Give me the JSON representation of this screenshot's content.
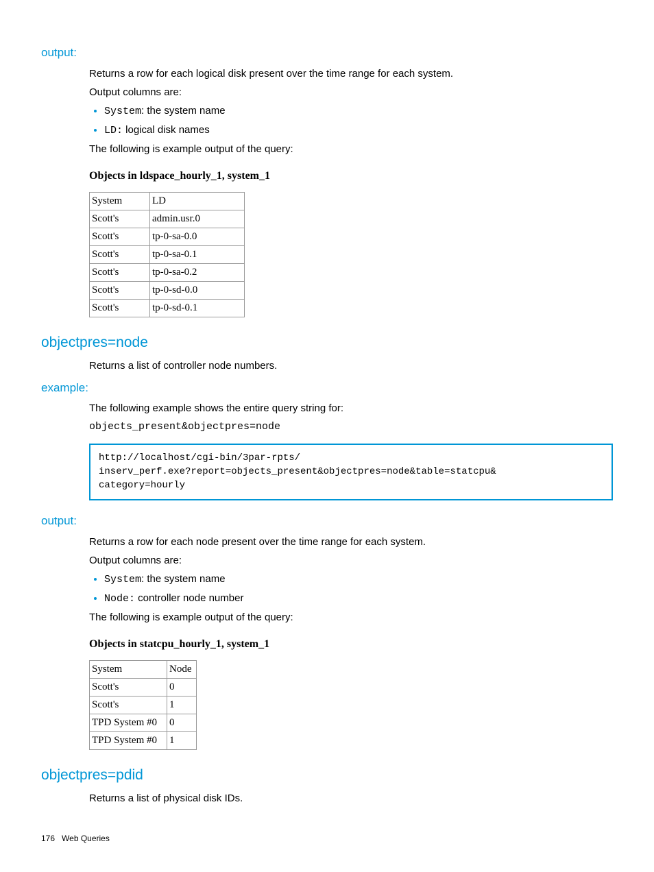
{
  "section1": {
    "heading": "output:",
    "p1": "Returns a row for each logical disk present over the time range for each system.",
    "p2": "Output columns are:",
    "li1_code": "System",
    "li1_text": ": the system name",
    "li2_code": "LD:",
    "li2_text": " logical disk names",
    "p3": "The following is example output of the query:",
    "table_title": "Objects in ldspace_hourly_1, system_1",
    "headers": [
      "System",
      "LD"
    ],
    "rows": [
      [
        "Scott's",
        "admin.usr.0"
      ],
      [
        "Scott's",
        "tp-0-sa-0.0"
      ],
      [
        "Scott's",
        "tp-0-sa-0.1"
      ],
      [
        "Scott's",
        "tp-0-sa-0.2"
      ],
      [
        "Scott's",
        "tp-0-sd-0.0"
      ],
      [
        "Scott's",
        "tp-0-sd-0.1"
      ]
    ]
  },
  "section2": {
    "heading": "objectpres=node",
    "p1": "Returns a list of controller node numbers."
  },
  "section3": {
    "heading": "example:",
    "p1": "The following example shows the entire query string for:",
    "code1": "objects_present&objectpres=node",
    "codebox": "http://localhost/cgi-bin/3par-rpts/\ninserv_perf.exe?report=objects_present&objectpres=node&table=statcpu&\ncategory=hourly"
  },
  "section4": {
    "heading": "output:",
    "p1": "Returns a row for each node present over the time range for each system.",
    "p2": "Output columns are:",
    "li1_code": "System",
    "li1_text": ": the system name",
    "li2_code": "Node:",
    "li2_text": " controller node number",
    "p3": "The following is example output of the query:",
    "table_title": "Objects in statcpu_hourly_1, system_1",
    "headers": [
      "System",
      "Node"
    ],
    "rows": [
      [
        "Scott's",
        "0"
      ],
      [
        "Scott's",
        "1"
      ],
      [
        "TPD System #0",
        "0"
      ],
      [
        "TPD System #0",
        "1"
      ]
    ]
  },
  "section5": {
    "heading": "objectpres=pdid",
    "p1": "Returns a list of physical disk IDs."
  },
  "footer": {
    "page": "176",
    "label": "Web Queries"
  }
}
